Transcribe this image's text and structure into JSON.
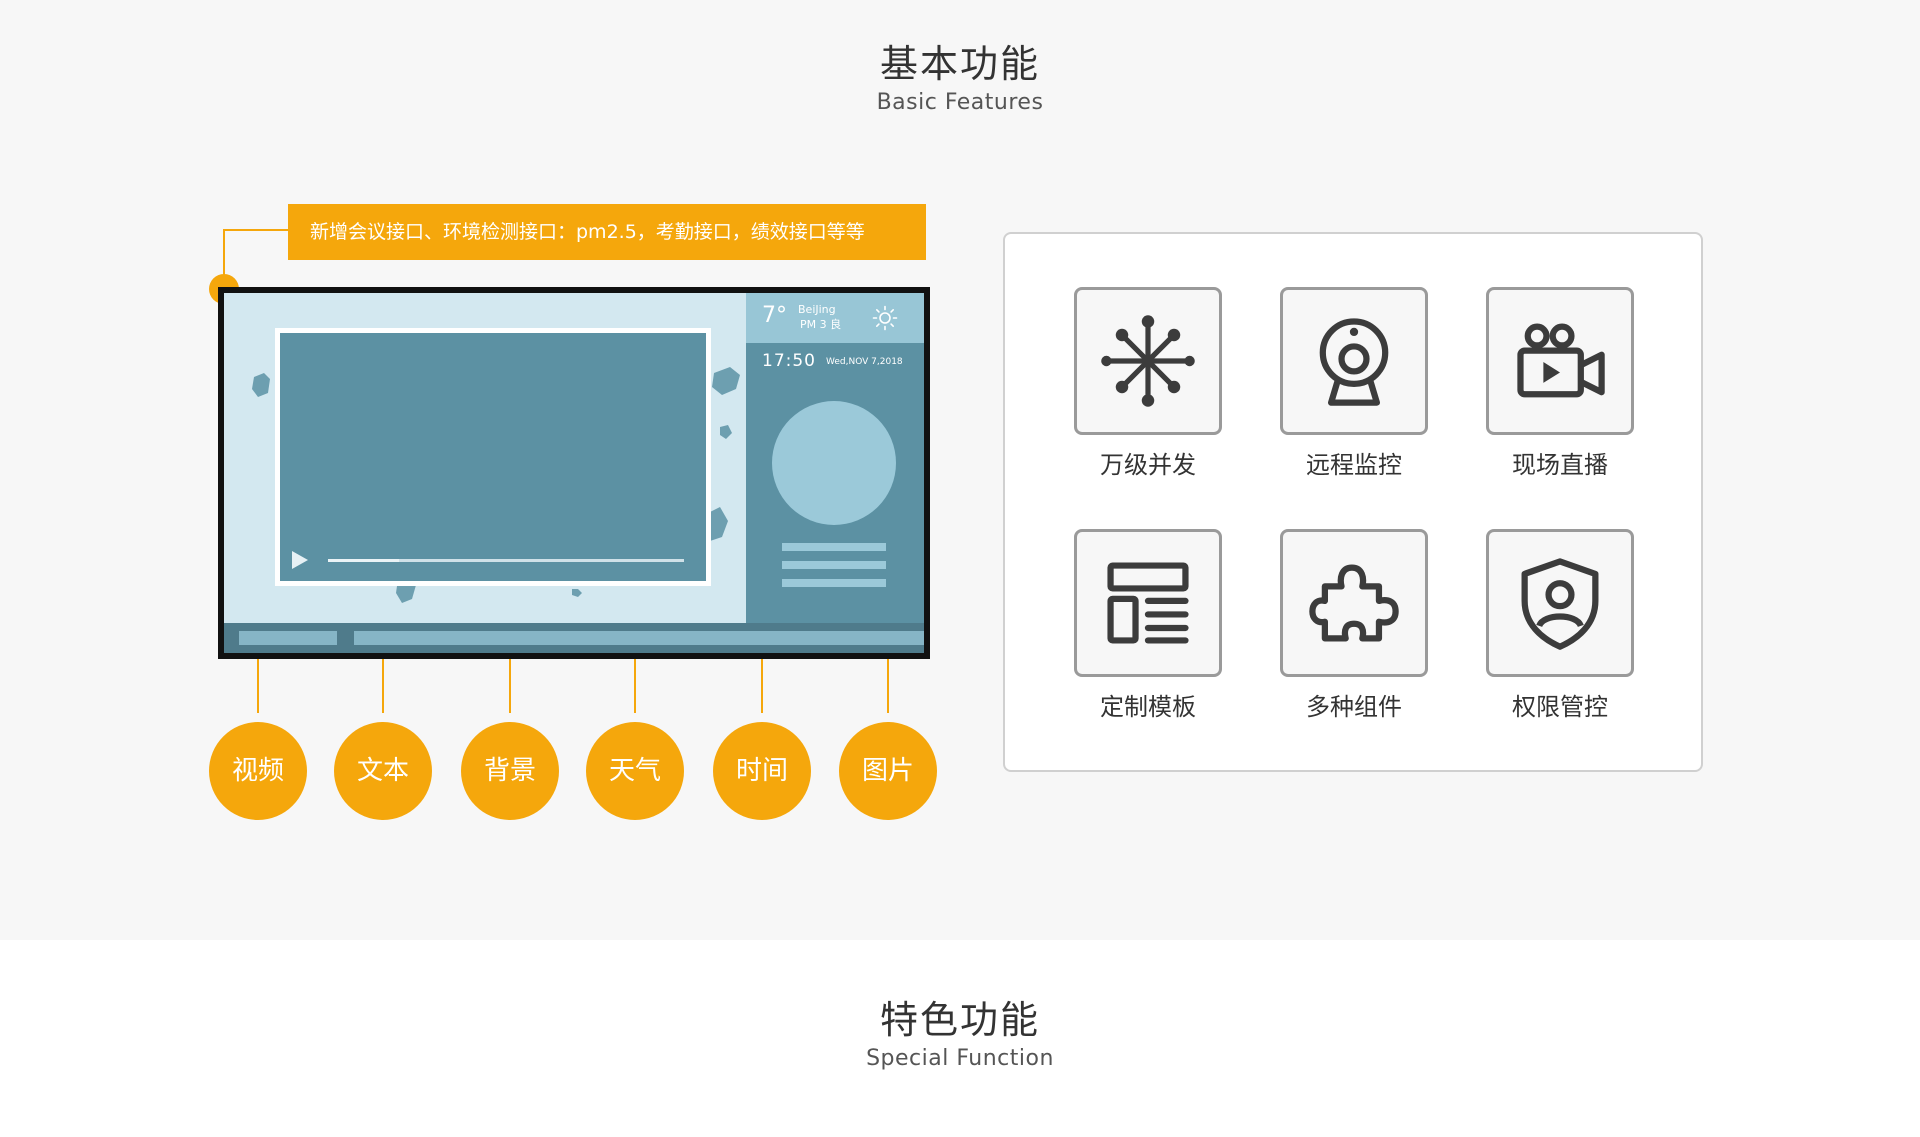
{
  "basic_section": {
    "title_cn": "基本功能",
    "title_en": "Basic Features"
  },
  "callout": {
    "text": "新增会议接口、环境检测接口：pm2.5，考勤接口，绩效接口等等"
  },
  "screen": {
    "temperature": "7°",
    "city": "BeiJing",
    "ampm": "PM 3  良",
    "time": "17:50",
    "date": "Wed,NOV 7,2018",
    "video_progress_percent": 20
  },
  "badges": [
    {
      "label": "视频"
    },
    {
      "label": "文本"
    },
    {
      "label": "背景"
    },
    {
      "label": "天气"
    },
    {
      "label": "时间"
    },
    {
      "label": "图片"
    }
  ],
  "features": [
    {
      "label": "万级并发",
      "icon": "network-node-icon"
    },
    {
      "label": "远程监控",
      "icon": "webcam-icon"
    },
    {
      "label": "现场直播",
      "icon": "video-camera-icon"
    },
    {
      "label": "定制模板",
      "icon": "layout-template-icon"
    },
    {
      "label": "多种组件",
      "icon": "puzzle-icon"
    },
    {
      "label": "权限管控",
      "icon": "shield-user-icon"
    }
  ],
  "special_section": {
    "title_cn": "特色功能",
    "title_en": "Special Function"
  },
  "colors": {
    "accent": "#f5a70c",
    "screen_blue": "#5c91a3",
    "screen_light": "#d3e8f0",
    "icon_gray": "#555555"
  }
}
